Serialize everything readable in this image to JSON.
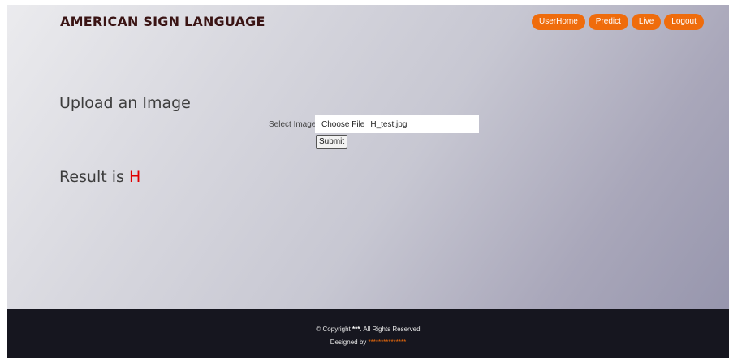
{
  "brand": "AMERICAN SIGN LANGUAGE",
  "nav": {
    "items": [
      {
        "label": "UserHome"
      },
      {
        "label": "Predict"
      },
      {
        "label": "Live"
      },
      {
        "label": "Logout"
      }
    ]
  },
  "upload": {
    "heading": "Upload an Image",
    "select_label": "Select Image",
    "choose_button": "Choose File",
    "file_name": "H_test.jpg",
    "submit_label": "Submit"
  },
  "result": {
    "prefix": "Result is ",
    "value": "H"
  },
  "footer": {
    "copyright_prefix": "© Copyright ",
    "copyright_owner": "***",
    "copyright_suffix": ". All Rights Reserved",
    "designed_prefix": "Designed by ",
    "designer": "***************"
  },
  "colors": {
    "accent": "#ef6c0c",
    "result": "#e00000",
    "footer_bg": "#16161f"
  }
}
